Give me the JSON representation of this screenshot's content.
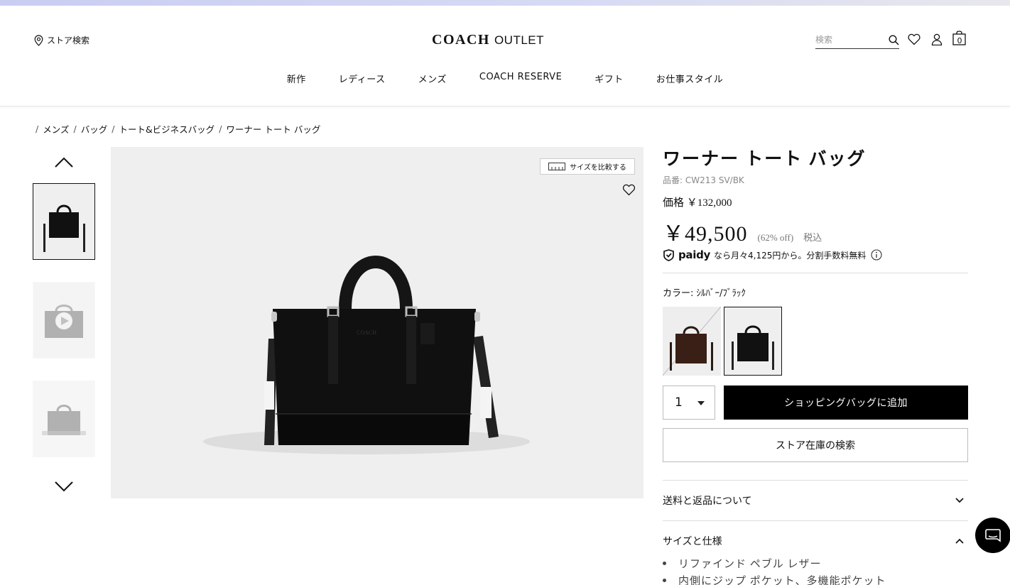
{
  "header": {
    "store_finder_label": "ストア検索",
    "logo_main": "COACH",
    "logo_sub": "OUTLET",
    "search_placeholder": "検索",
    "cart_count": "0"
  },
  "nav": {
    "items": [
      {
        "label": "新作"
      },
      {
        "label": "レディース"
      },
      {
        "label": "メンズ"
      },
      {
        "label": "COACH RESERVE"
      },
      {
        "label": "ギフト"
      },
      {
        "label": "お仕事スタイル"
      }
    ]
  },
  "breadcrumb": {
    "items": [
      {
        "label": "メンズ"
      },
      {
        "label": "バッグ"
      },
      {
        "label": "トート&ビジネスバッグ"
      },
      {
        "label": "ワーナー トート バッグ"
      }
    ]
  },
  "gallery": {
    "compare_label": "サイズを比較する"
  },
  "product": {
    "title": "ワーナー トート バッグ",
    "sku": "品番: CW213 SV/BK",
    "list_price": "価格 ￥132,000",
    "sale_price": "￥49,500",
    "discount": "(62% off)",
    "tax_label": "税込",
    "paidy_logo": "paidy",
    "paidy_text": "なら月々4,125円から。分割手数料無料",
    "color_label": "カラー: ｼﾙﾊﾞｰ/ﾌﾞﾗｯｸ",
    "quantity": "1",
    "add_to_bag": "ショッピングバッグに追加",
    "store_stock": "ストア在庫の検索",
    "shipping_label": "送料と返品について",
    "specs_label": "サイズと仕様",
    "specs": [
      "リファインド ペブル レザー",
      "内側にジップ ポケット、多機能ポケット"
    ]
  },
  "colors": {
    "accent": "#000000",
    "background": "#ffffff",
    "image_bg": "#efefef"
  }
}
